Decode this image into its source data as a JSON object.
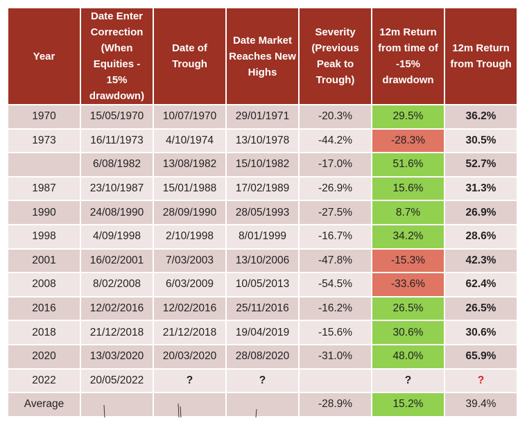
{
  "headers": [
    "Year",
    "Date Enter Correction (When Equities - 15% drawdown)",
    "Date of Trough",
    "Date Market Reaches New Highs",
    "Severity (Previous Peak to Trough)",
    "12m Return from time of -15% drawdown",
    "12m Return from Trough"
  ],
  "rows": [
    [
      "1970",
      "15/05/1970",
      "10/07/1970",
      "29/01/1971",
      "-20.3%",
      "29.5%",
      "36.2%"
    ],
    [
      "1973",
      "16/11/1973",
      "4/10/1974",
      "13/10/1978",
      "-44.2%",
      "-28.3%",
      "30.5%"
    ],
    [
      "",
      "6/08/1982",
      "13/08/1982",
      "15/10/1982",
      "-17.0%",
      "51.6%",
      "52.7%"
    ],
    [
      "1987",
      "23/10/1987",
      "15/01/1988",
      "17/02/1989",
      "-26.9%",
      "15.6%",
      "31.3%"
    ],
    [
      "1990",
      "24/08/1990",
      "28/09/1990",
      "28/05/1993",
      "-27.5%",
      "8.7%",
      "26.9%"
    ],
    [
      "1998",
      "4/09/1998",
      "2/10/1998",
      "8/01/1999",
      "-16.7%",
      "34.2%",
      "28.6%"
    ],
    [
      "2001",
      "16/02/2001",
      "7/03/2003",
      "13/10/2006",
      "-47.8%",
      "-15.3%",
      "42.3%"
    ],
    [
      "2008",
      "8/02/2008",
      "6/03/2009",
      "10/05/2013",
      "-54.5%",
      "-33.6%",
      "62.4%"
    ],
    [
      "2016",
      "12/02/2016",
      "12/02/2016",
      "25/11/2016",
      "-16.2%",
      "26.5%",
      "26.5%"
    ],
    [
      "2018",
      "21/12/2018",
      "21/12/2018",
      "19/04/2019",
      "-15.6%",
      "30.6%",
      "30.6%"
    ],
    [
      "2020",
      "13/03/2020",
      "20/03/2020",
      "28/08/2020",
      "-31.0%",
      "48.0%",
      "65.9%"
    ],
    [
      "2022",
      "20/05/2022",
      "?",
      "?",
      "",
      "?",
      "?"
    ],
    [
      "Average",
      "",
      "",
      "",
      "-28.9%",
      "15.2%",
      "39.4%"
    ]
  ],
  "colors": {
    "header_bg": "#9c3124",
    "row_dark": "#e1cfcd",
    "row_light": "#efe5e4",
    "positive": "#92d050",
    "negative": "#e07563",
    "pending_mark": "#e02020"
  }
}
